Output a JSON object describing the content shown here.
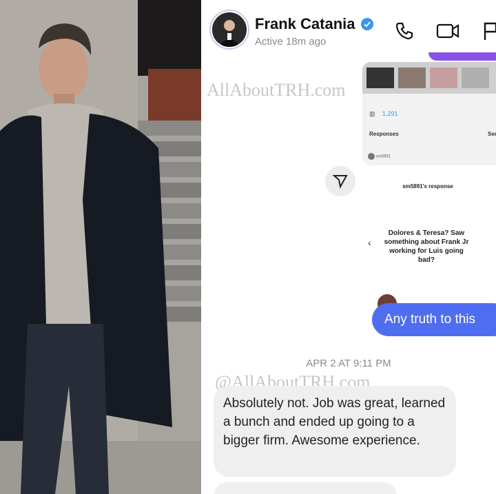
{
  "photo": {
    "alt": "man-in-dark-coat"
  },
  "header": {
    "name": "Frank Catania",
    "status": "Active 18m ago",
    "icons": [
      "phone-icon",
      "video-icon",
      "flag-icon"
    ],
    "colors": {
      "verified": "#3897f0",
      "avatar_ring": "#d8c2ec"
    }
  },
  "watermarks": [
    "AllAboutTRH.com",
    "@AllAboutTRH.com"
  ],
  "shared_story": {
    "likes": "1,291",
    "responses_label": "Responses",
    "see_label": "See",
    "user1": "sm5891",
    "response_heading": "sm5891's response",
    "question": "Dolores & Teresa? Saw something about Frank Jr working for Luis going bad?"
  },
  "messages": {
    "outgoing": "Any truth to this",
    "timestamp": "APR 2 AT 9:11 PM",
    "incoming": "Absolutely not. Job was great, learned a bunch and ended up going to a bigger firm. Awesome experience."
  },
  "colors": {
    "outgoing_bubble": "#4f6df0",
    "incoming_bubble": "#efefef"
  }
}
